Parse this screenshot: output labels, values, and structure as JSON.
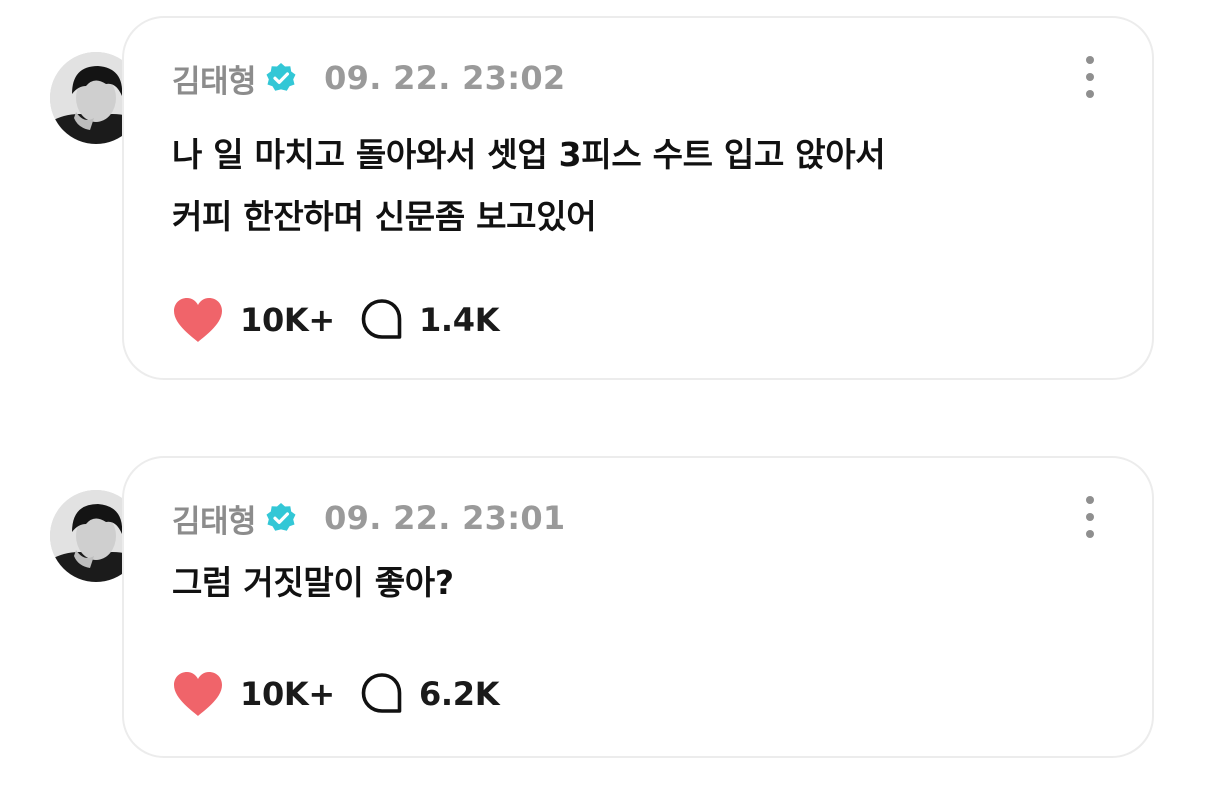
{
  "theme": {
    "heart_color": "#f0646a",
    "verified_color": "#33c7d6",
    "muted_text": "#8c8c8c"
  },
  "posts": [
    {
      "author": "김태형",
      "verified": true,
      "verified_icon": "verified-badge-icon",
      "timestamp": "09. 22. 23:02",
      "text_lines": [
        "나 일 마치고 돌아와서 셋업 3피스 수트 입고 앉아서",
        "커피 한잔하며 신문좀 보고있어"
      ],
      "likes": "10K+",
      "comments": "1.4K"
    },
    {
      "author": "김태형",
      "verified": true,
      "verified_icon": "verified-badge-icon",
      "timestamp": "09. 22. 23:01",
      "text_lines": [
        "그럼 거짓말이 좋아?"
      ],
      "likes": "10K+",
      "comments": "6.2K"
    }
  ]
}
